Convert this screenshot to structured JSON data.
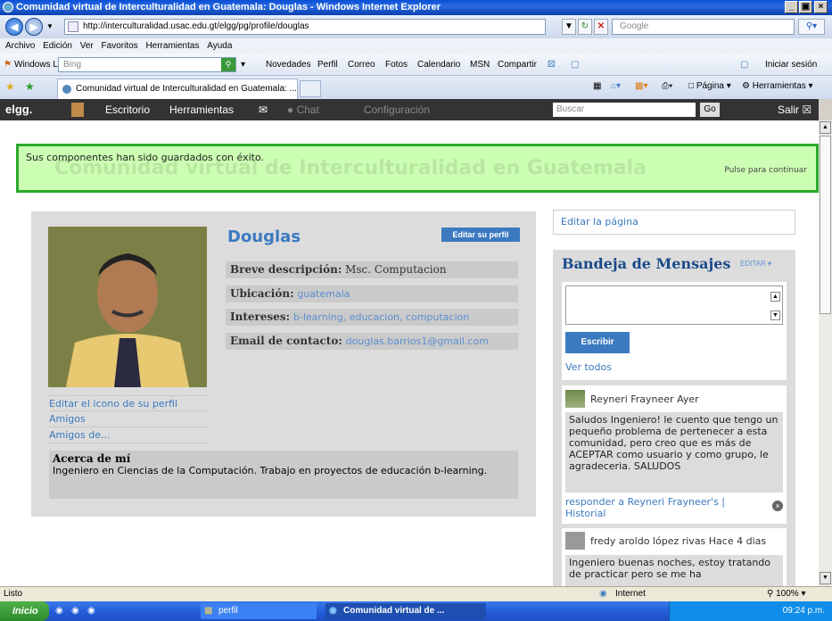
{
  "window": {
    "title": "Comunidad virtual de Interculturalidad en Guatemala: Douglas - Windows Internet Explorer",
    "min": "_",
    "max": "×"
  },
  "address": {
    "url": "http://interculturalidad.usac.edu.gt/elgg/pg/profile/douglas",
    "search_placeholder": "Google"
  },
  "menubar": [
    "Archivo",
    "Edición",
    "Ver",
    "Favoritos",
    "Herramientas",
    "Ayuda"
  ],
  "linksbar": {
    "windows_live": "Windows Live",
    "bing": "Bing",
    "items": [
      "Novedades",
      "Perfil",
      "Correo",
      "Fotos",
      "Calendario",
      "MSN",
      "Compartir"
    ],
    "signin": "Iniciar sesión"
  },
  "tabbar": {
    "tab_title": "Comunidad virtual de Interculturalidad en Guatemala: ...",
    "pagina": "Página",
    "herramientas": "Herramientas"
  },
  "elggbar": {
    "logo": "elgg.",
    "escritorio": "Escritorio",
    "herramientas": "Herramientas",
    "chat": "Chat",
    "configuracion": "Configuración",
    "search_placeholder": "Buscar",
    "go": "Go",
    "salir": "Salir"
  },
  "notice": {
    "message": "Sus componentes han sido guardados con éxito.",
    "continue": "Pulse para continuar",
    "ghost": "Comunidad virtual de Interculturalidad en Guatemala"
  },
  "profile": {
    "name": "Douglas",
    "edit_button": "Editar su perfil",
    "fields": [
      {
        "label": "Breve descripción:",
        "value": "Msc. Computacion"
      },
      {
        "label": "Ubicación:",
        "value": "guatemala"
      },
      {
        "label": "Intereses:",
        "value": "b-learning, educacion, computacion"
      },
      {
        "label": "Email de contacto:",
        "value": "douglas.barrios1@gmail.com"
      }
    ],
    "links": [
      "Editar el icono de su perfil",
      "Amigos",
      "Amigos de..."
    ],
    "about_title": "Acerca de mí",
    "about_text": "Ingeniero en Ciencias de la Computación. Trabajo en proyectos de educación b-learning."
  },
  "sidebar": {
    "edit_page": "Editar la página",
    "inbox_title": "Bandeja de Mensajes",
    "inbox_edit": "EDITAR",
    "write_button": "Escribir",
    "view_all": "Ver todos",
    "posts": [
      {
        "author": "Reyneri Frayneer Ayer",
        "text": "Saludos Ingeniero! le cuento que tengo un pequeño problema de pertenecer a esta comunidad, pero creo que es más de ACEPTAR como usuario y como grupo, le agradeceria. SALUDOS",
        "reply": "responder a Reyneri Frayneer's | Historial"
      },
      {
        "author": "fredy aroldo lópez rivas Hace 4 dias",
        "text": "Ingeniero buenas noches, estoy tratando de practicar pero se me ha"
      }
    ]
  },
  "status": {
    "left": "Listo",
    "zone": "Internet",
    "zoom": "100%"
  },
  "taskbar": {
    "start": "Inicio",
    "folder": "perfil",
    "window": "Comunidad virtual de ...",
    "clock": "09:24 p.m."
  }
}
